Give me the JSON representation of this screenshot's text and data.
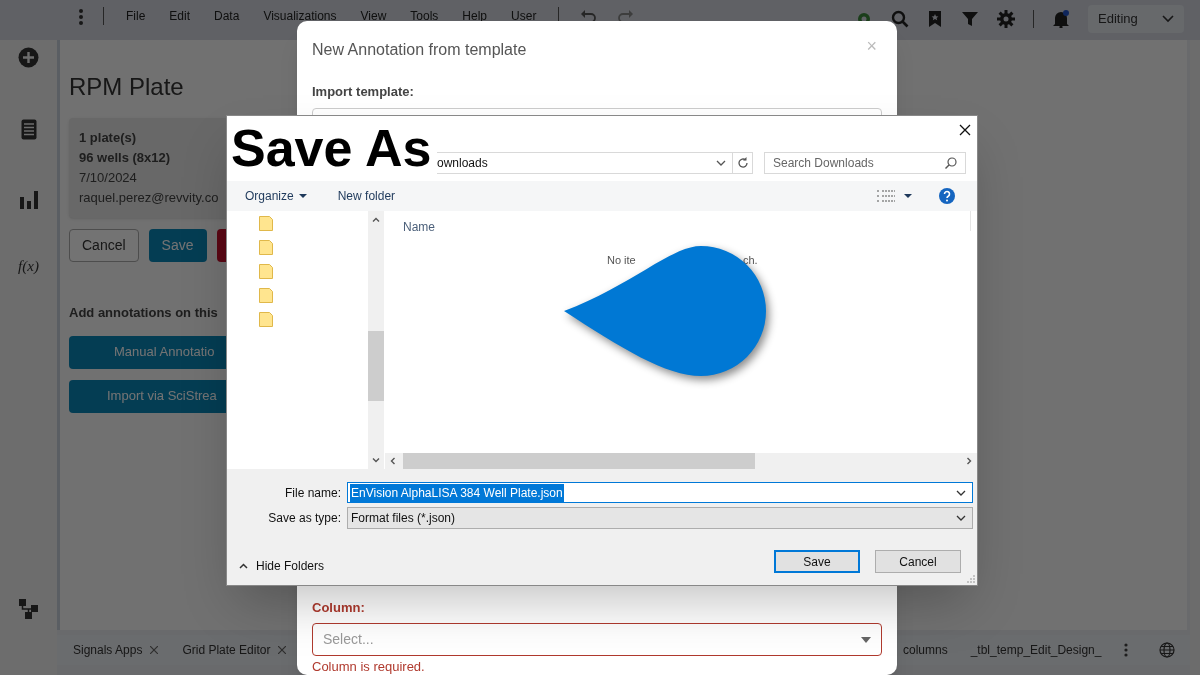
{
  "menu_bar": {
    "items": [
      "File",
      "Edit",
      "Data",
      "Visualizations",
      "View",
      "Tools",
      "Help",
      "User"
    ],
    "mode": "Editing"
  },
  "side_rail": {
    "formula_label": "f(x)"
  },
  "plate_panel": {
    "title": "RPM Plate",
    "info": [
      {
        "text": "1 plate(s)",
        "bold": true
      },
      {
        "text": "96 wells (8x12)",
        "bold": true
      },
      {
        "text": "7/10/2024",
        "bold": false
      },
      {
        "text": "raquel.perez@revvity.co",
        "bold": false
      }
    ],
    "buttons": [
      {
        "label": "Cancel",
        "kind": "outline"
      },
      {
        "label": "Save",
        "kind": "primary"
      },
      {
        "kind": "danger"
      }
    ],
    "annotations_label": "Add annotations on this",
    "actions": [
      "Manual Annotatio",
      "Import via SciStrea"
    ]
  },
  "bottom_tabs": [
    {
      "label": "Signals Apps",
      "closable": true
    },
    {
      "label": "Grid Plate Editor",
      "closable": true
    }
  ],
  "bottom_right_tabs": [
    "columns",
    "_tbl_temp_Edit_Design_"
  ],
  "annotation_modal": {
    "title": "New Annotation from template",
    "close": "×",
    "import_label": "Import template:",
    "column_label": "Column:",
    "column_placeholder": "Select...",
    "column_invalid": true,
    "column_error": "Column is required."
  },
  "save_dialog": {
    "title": "Save As",
    "address": "ownloads",
    "search_placeholder": "Search Downloads",
    "toolbar": [
      "Organize",
      "New folder"
    ],
    "column_header": "Name",
    "empty_fragments": [
      "No ite",
      "ch."
    ],
    "file_name_label": "File name:",
    "file_name": "EnVision AlphaLISA 384 Well Plate.json",
    "file_name_selected": true,
    "type_label": "Save as type:",
    "type_value": "Format files (*.json)",
    "hide_folders": "Hide Folders",
    "buttons": [
      {
        "label": "Save",
        "default": true
      },
      {
        "label": "Cancel",
        "default": false
      }
    ]
  }
}
